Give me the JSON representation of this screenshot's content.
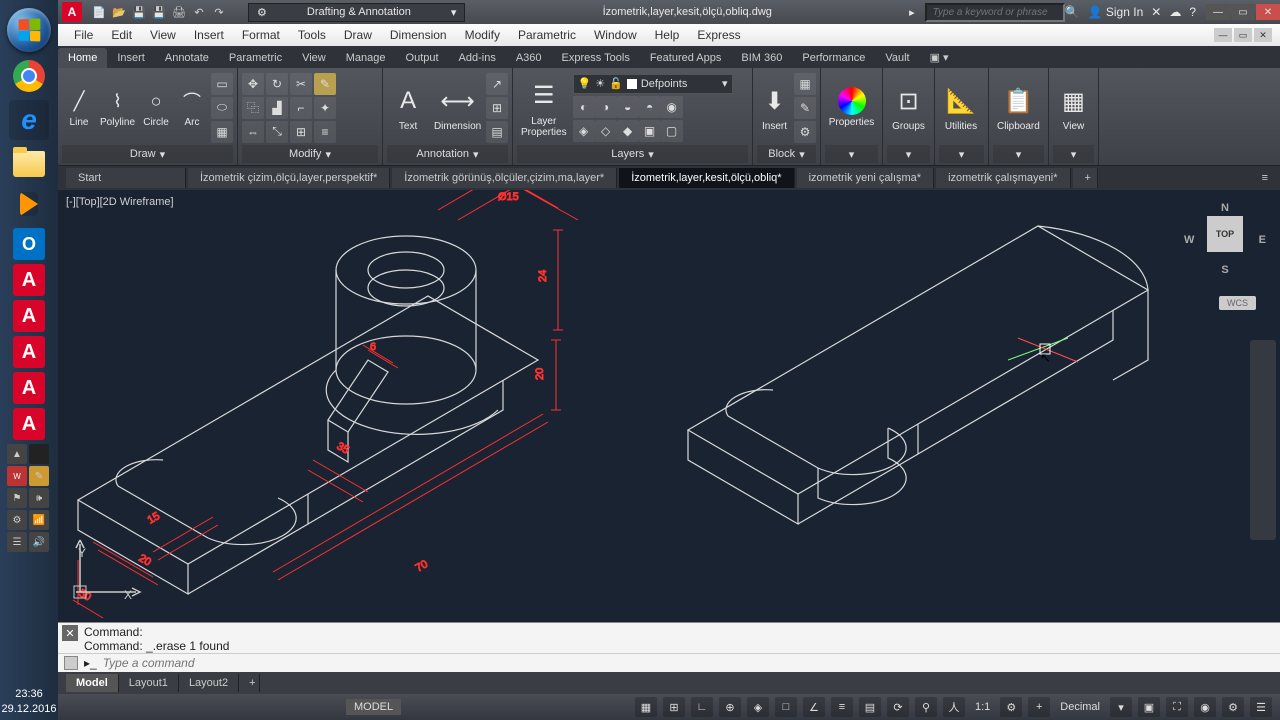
{
  "taskbar": {
    "clock_time": "23:36",
    "clock_date": "29.12.2016"
  },
  "titlebar": {
    "workspace": "Drafting & Annotation",
    "doc": "İzometrik,layer,kesit,ölçü,obliq.dwg",
    "search_ph": "Type a keyword or phrase",
    "signin": "Sign In"
  },
  "menus": [
    "File",
    "Edit",
    "View",
    "Insert",
    "Format",
    "Tools",
    "Draw",
    "Dimension",
    "Modify",
    "Parametric",
    "Window",
    "Help",
    "Express"
  ],
  "ribtabs": [
    "Home",
    "Insert",
    "Annotate",
    "Parametric",
    "View",
    "Manage",
    "Output",
    "Add-ins",
    "A360",
    "Express Tools",
    "Featured Apps",
    "BIM 360",
    "Performance",
    "Vault"
  ],
  "ribbon": {
    "draw": {
      "title": "Draw",
      "line": "Line",
      "polyline": "Polyline",
      "circle": "Circle",
      "arc": "Arc"
    },
    "modify": {
      "title": "Modify"
    },
    "annotation": {
      "title": "Annotation",
      "text": "Text",
      "dimension": "Dimension"
    },
    "layers": {
      "title": "Layers",
      "props": "Layer\nProperties",
      "current": "Defpoints"
    },
    "block": {
      "title": "Block",
      "insert": "Insert"
    },
    "properties": "Properties",
    "groups": "Groups",
    "utilities": "Utilities",
    "clipboard": "Clipboard",
    "view": "View"
  },
  "filetabs": {
    "start": "Start",
    "t1": "İzometrik çizim,ölçü,layer,perspektif*",
    "t2": "İzometrik görünüş,ölçüler,çizim,ma,layer*",
    "t3": "İzometrik,layer,kesit,ölçü,obliq*",
    "t4": "izometrik yeni çalışma*",
    "t5": "izometrik çalışmayeni*"
  },
  "viewport": {
    "label": "[-][Top][2D Wireframe]",
    "cube": "TOP",
    "wcs": "WCS"
  },
  "dims": {
    "d1": "Ø15",
    "d2": "24",
    "d3": "6",
    "d4": "35",
    "d5": "15",
    "d6": "20",
    "d7": "50",
    "d8": "70",
    "d9": "20"
  },
  "cmd": {
    "l1": "Command:",
    "l2": "Command: _.erase 1 found",
    "ph": "Type a command"
  },
  "layout": {
    "model": "Model",
    "l1": "Layout1",
    "l2": "Layout2"
  },
  "status": {
    "model": "MODEL",
    "scale": "1:1",
    "units": "Decimal"
  }
}
